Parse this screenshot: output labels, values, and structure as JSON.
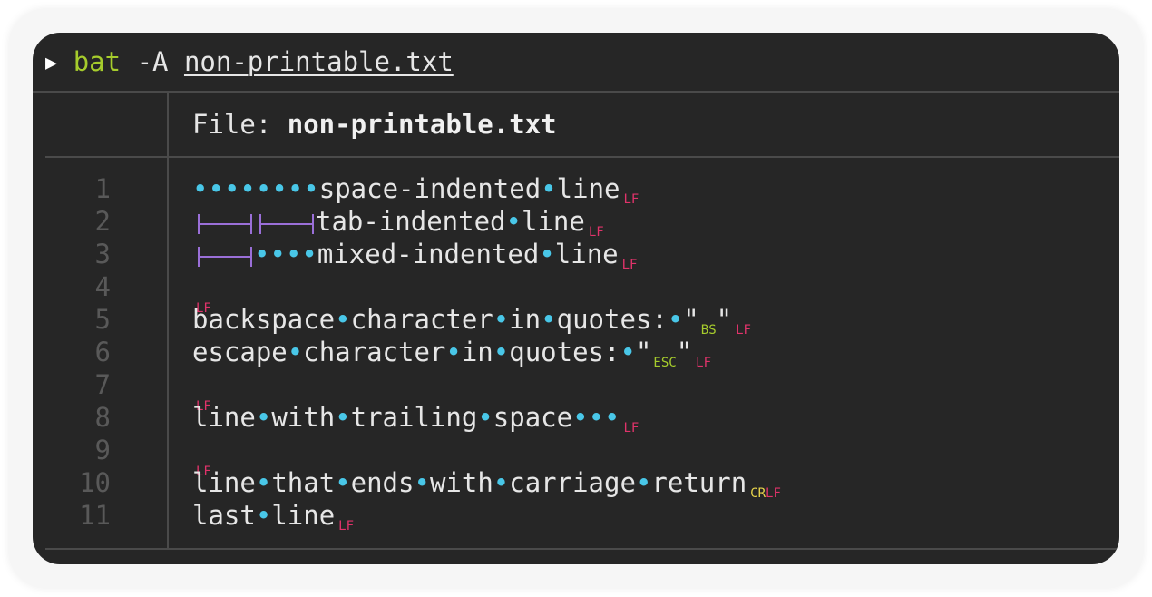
{
  "command": {
    "prompt_symbol": "▶",
    "program": "bat",
    "flag": "-A",
    "argument": "non-printable.txt"
  },
  "header": {
    "label": "File: ",
    "filename": "non-printable.txt"
  },
  "line_numbers": [
    "1",
    "2",
    "3",
    "4",
    "5",
    "6",
    "7",
    "8",
    "9",
    "10",
    "11"
  ],
  "lines": {
    "l1_text": "space-indented",
    "l1_text2": "line",
    "l2_text": "tab-indented",
    "l2_text2": "line",
    "l3_text": "mixed-indented",
    "l3_text2": "line",
    "l5_w1": "backspace",
    "l5_w2": "character",
    "l5_w3": "in",
    "l5_w4": "quotes:",
    "l5_q1": "\"",
    "l5_ctl": "BS",
    "l5_q2": "\"",
    "l6_w1": "escape",
    "l6_w2": "character",
    "l6_w3": "in",
    "l6_w4": "quotes:",
    "l6_q1": "\"",
    "l6_ctl": "ESC",
    "l6_q2": "\"",
    "l8_w1": "line",
    "l8_w2": "with",
    "l8_w3": "trailing",
    "l8_w4": "space",
    "l10_w1": "line",
    "l10_w2": "that",
    "l10_w3": "ends",
    "l10_w4": "with",
    "l10_w5": "carriage",
    "l10_w6": "return",
    "l11_w1": "last",
    "l11_w2": "line"
  },
  "markers": {
    "space_dot": "•",
    "lf": "LF",
    "cr": "CR"
  },
  "colors": {
    "background": "#262626",
    "program": "#a6cc2c",
    "space_marker": "#49c7e8",
    "tab_marker": "#9a6fd8",
    "lf_marker": "#e0336a",
    "control_marker": "#a6cc2c",
    "cr_marker": "#e6d24a",
    "line_number": "#595959"
  }
}
